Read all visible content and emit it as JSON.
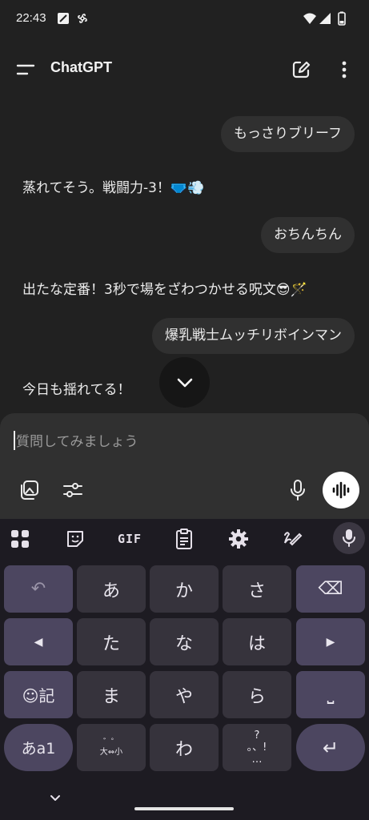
{
  "status_bar": {
    "time": "22:43"
  },
  "header": {
    "title": "ChatGPT"
  },
  "chat": {
    "messages": [
      {
        "role": "user",
        "text": "もっさりブリーフ"
      },
      {
        "role": "assistant",
        "text": "蒸れてそう。戦闘力-3！🩲💨"
      },
      {
        "role": "user",
        "text": "おちんちん"
      },
      {
        "role": "assistant",
        "text": "出たな定番！3秒で場をざわつかせる呪文😎🪄"
      },
      {
        "role": "user",
        "text": "爆乳戦士ムッチリボインマン"
      },
      {
        "role": "assistant",
        "text": "今日も揺れてる！"
      }
    ]
  },
  "composer": {
    "placeholder": "質問してみましょう"
  },
  "keyboard": {
    "toolbar": {
      "gif_label": "GIF"
    },
    "keys": {
      "undo": "↶",
      "a": "あ",
      "ka": "か",
      "sa": "さ",
      "backspace": "⌫",
      "left": "◀",
      "ta": "た",
      "na": "な",
      "ha": "は",
      "right": "▶",
      "emoji_symbol": "☺記",
      "ma": "ま",
      "ya": "や",
      "ra": "ら",
      "space": "⎵",
      "mode": "あa1",
      "dakuten": "゛゜\n大⇔小",
      "wa": "わ",
      "punct": "?\n。、!\n…",
      "enter": "↵"
    }
  },
  "colors": {
    "background": "#212121",
    "bubble": "#303030",
    "keyboard_bg": "#1d1b22",
    "key": "#36333c",
    "function_key": "#4c4660"
  }
}
